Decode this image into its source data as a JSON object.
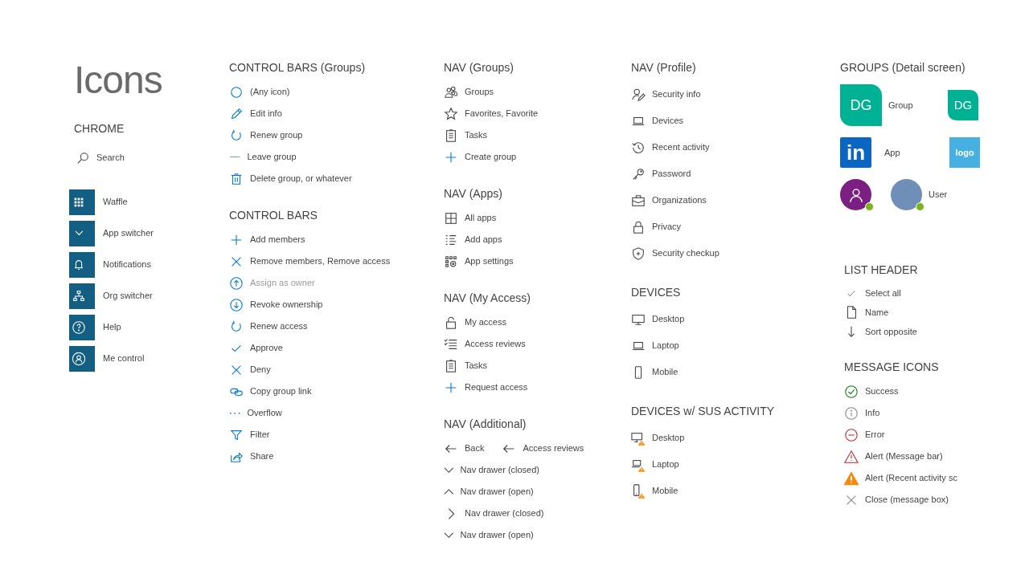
{
  "columns": [
    {
      "title": "Icons",
      "sections": [
        {
          "heading": "CHROME",
          "items": [
            {
              "kind": "search",
              "label": "Search"
            },
            {
              "kind": "waffle",
              "label": "Waffle"
            },
            {
              "kind": "app-switcher",
              "label": "App switcher"
            },
            {
              "kind": "bell",
              "label": "Notifications"
            },
            {
              "kind": "org",
              "label": "Org switcher"
            },
            {
              "kind": "help",
              "label": "Help"
            },
            {
              "kind": "person",
              "label": "Me control"
            }
          ]
        }
      ]
    },
    {
      "sections": [
        {
          "heading": "CONTROL BARS (Groups)",
          "items": [
            {
              "kind": "circle",
              "label": "(Any icon)"
            },
            {
              "kind": "pencil",
              "label": "Edit info"
            },
            {
              "kind": "refresh",
              "label": "Renew group"
            },
            {
              "kind": "minus",
              "label": "Leave group"
            },
            {
              "kind": "trash",
              "label": "Delete group, or whatever"
            }
          ]
        },
        {
          "heading": "CONTROL BARS",
          "items": [
            {
              "kind": "plus",
              "label": "Add members",
              "disabled": false
            },
            {
              "kind": "x",
              "label": "Remove members, Remove access",
              "disabled": false
            },
            {
              "kind": "arrow-up-circle",
              "label": "Assign as owner",
              "disabled": true
            },
            {
              "kind": "arrow-down-circle",
              "label": "Revoke ownership",
              "disabled": false
            },
            {
              "kind": "refresh",
              "label": "Renew access",
              "disabled": false
            },
            {
              "kind": "check",
              "label": "Approve",
              "disabled": false
            },
            {
              "kind": "x",
              "label": "Deny",
              "disabled": false
            },
            {
              "kind": "link",
              "label": "Copy group link",
              "disabled": false
            },
            {
              "kind": "dots",
              "label": "Overflow",
              "disabled": false
            },
            {
              "kind": "filter",
              "label": "Filter",
              "disabled": false
            },
            {
              "kind": "share",
              "label": "Share",
              "disabled": false
            }
          ]
        }
      ]
    },
    {
      "sections": [
        {
          "heading": "NAV (Groups)",
          "items": [
            {
              "kind": "groups",
              "label": "Groups"
            },
            {
              "kind": "star",
              "label": "Favorites, Favorite"
            },
            {
              "kind": "tasks",
              "label": "Tasks"
            },
            {
              "kind": "plus",
              "label": "Create group"
            }
          ]
        },
        {
          "heading": "NAV (Apps)",
          "items": [
            {
              "kind": "all-apps",
              "label": "All apps"
            },
            {
              "kind": "list",
              "label": "Add apps"
            },
            {
              "kind": "app-settings",
              "label": "App settings"
            }
          ]
        },
        {
          "heading": "NAV (My Access)",
          "items": [
            {
              "kind": "lock-open",
              "label": "My access"
            },
            {
              "kind": "checklist",
              "label": "Access reviews"
            },
            {
              "kind": "tasks",
              "label": "Tasks"
            },
            {
              "kind": "plus",
              "label": "Request access"
            }
          ]
        },
        {
          "heading": "NAV (Additional)",
          "items": [
            {
              "kind": "arrow-left",
              "label": "Back",
              "beside": {
                "kind": "arrow-left",
                "label": "Access reviews"
              }
            },
            {
              "kind": "chevron-down",
              "label": "Nav drawer (closed)"
            },
            {
              "kind": "chevron-up",
              "label": "Nav drawer (open)"
            },
            {
              "kind": "chevron-right",
              "label": "Nav drawer (closed)"
            },
            {
              "kind": "chevron-down",
              "label": "Nav drawer (open)"
            }
          ]
        }
      ]
    },
    {
      "sections": [
        {
          "heading": "NAV (Profile)",
          "items": [
            {
              "kind": "person-edit",
              "label": "Security info"
            },
            {
              "kind": "laptop",
              "label": "Devices"
            },
            {
              "kind": "history",
              "label": "Recent activity"
            },
            {
              "kind": "key",
              "label": "Password"
            },
            {
              "kind": "briefcase",
              "label": "Organizations"
            },
            {
              "kind": "lock",
              "label": "Privacy"
            },
            {
              "kind": "shield",
              "label": "Security checkup"
            }
          ]
        },
        {
          "heading": "DEVICES",
          "items": [
            {
              "kind": "desktop",
              "label": "Desktop"
            },
            {
              "kind": "laptop",
              "label": "Laptop"
            },
            {
              "kind": "phone",
              "label": "Mobile"
            }
          ]
        },
        {
          "heading": "DEVICES w/ SUS ACTIVITY",
          "items": [
            {
              "kind": "desktop-warn",
              "label": "Desktop"
            },
            {
              "kind": "laptop-warn",
              "label": "Laptop"
            },
            {
              "kind": "phone-warn",
              "label": "Mobile"
            }
          ]
        }
      ]
    },
    {
      "groups_detail": {
        "heading": "GROUPS (Detail screen)",
        "rows": [
          {
            "kind": "group",
            "tile": "DG",
            "label": "Group",
            "small_tile": "DG"
          },
          {
            "kind": "app",
            "tile": "in",
            "label": "App",
            "small_tile": "logo"
          },
          {
            "kind": "user",
            "label": "User"
          }
        ]
      },
      "sections": [
        {
          "heading": "LIST HEADER",
          "items": [
            {
              "kind": "check-light",
              "label": "Select all"
            },
            {
              "kind": "doc",
              "label": "Name"
            },
            {
              "kind": "arrow-down",
              "label": "Sort opposite"
            }
          ]
        },
        {
          "heading": "MESSAGE ICONS",
          "items": [
            {
              "kind": "success",
              "label": "Success"
            },
            {
              "kind": "info",
              "label": "Info"
            },
            {
              "kind": "error",
              "label": "Error"
            },
            {
              "kind": "alert-outline",
              "label": "Alert (Message bar)"
            },
            {
              "kind": "alert-filled",
              "label": "Alert (Recent activity sc"
            },
            {
              "kind": "close",
              "label": "Close (message box)"
            }
          ]
        }
      ]
    }
  ]
}
